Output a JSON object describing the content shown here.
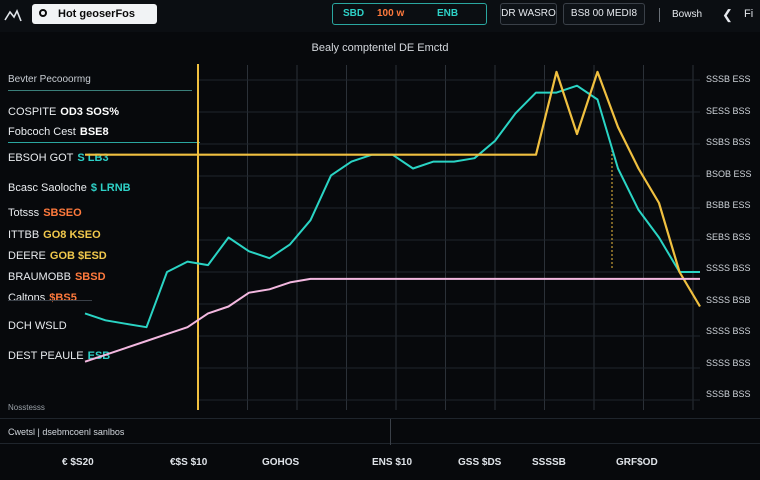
{
  "topbar": {
    "title": "Hot geoserFos",
    "ticker": {
      "symbol": "SBD",
      "value": "100 w",
      "change": "ENB"
    },
    "buttons": [
      "DR WASRO",
      "BS8 00 MEDI8"
    ],
    "search_label": "Bowsh",
    "back_glyph": "❮",
    "last_label": "Fi"
  },
  "chart_title": "Bealy comptentel DE Emctd",
  "left_panel": {
    "header": "Bevter Pecooormg",
    "rows": [
      {
        "label": "COSPITE",
        "value": "OD3 SOS%",
        "value_color": "#ffffff"
      },
      {
        "label": "Fobcoch Cest",
        "value": "BSE8",
        "value_color": "#ffffff"
      },
      {
        "label": "EBSOH GOT",
        "value": "S LB3",
        "value_color": "#2ed1c7"
      },
      {
        "label": "Bcasc Saoloche",
        "value": "$ LRNB",
        "value_color": "#2ed1c7"
      },
      {
        "label": "Totsss",
        "value": "SBSEO",
        "value_color": "#ff7a3d"
      },
      {
        "label": "ITTBB",
        "value": "GO8 KSEO",
        "value_color": "#f2c94c"
      },
      {
        "label": "DEERE",
        "value": "GOB $ESD",
        "value_color": "#f2c94c"
      },
      {
        "label": "BRAUMOBB",
        "value": "SBSD",
        "value_color": "#ff7a3d"
      },
      {
        "label": "Caltons",
        "value": "$BS5",
        "value_color": "#ff7a3d"
      },
      {
        "label": "DCH WSLD",
        "value": "",
        "value_color": "#ffffff"
      },
      {
        "label": "DEST PEAULE",
        "value": "ESB",
        "value_color": "#2ed1c7"
      }
    ],
    "footer": "Nosstesss"
  },
  "footer": {
    "left_text": "Cwetsl | dsebmcoenl sanlbos"
  },
  "chart_data": {
    "type": "line",
    "x": [
      0,
      1,
      2,
      3,
      4,
      5,
      6,
      7,
      8,
      9,
      10,
      11,
      12,
      13,
      14,
      15,
      16,
      17,
      18,
      19,
      20,
      21,
      22,
      23,
      24,
      25,
      26,
      27,
      28,
      29,
      30
    ],
    "xlim": [
      0,
      30
    ],
    "ylim": [
      0,
      100
    ],
    "x_tick_labels": [
      "€ $S20",
      "€$S $10",
      "GOHOS",
      "ENS $10",
      "GSS $DS",
      "SSSSB",
      "GRF$OD"
    ],
    "y_tick_labels": [
      "SSSB ESS",
      "SESS BSS",
      "SSBS BSS",
      "BSOB ESS",
      "BSBB ESS",
      "SEBS BSS",
      "SSSS BSS",
      "SSSS BSB",
      "SSSS BSS",
      "SSSS BSS",
      "SSSB BSS"
    ],
    "series": [
      {
        "color": "#2ad4c4",
        "values": [
          28,
          26,
          25,
          24,
          40,
          43,
          42,
          50,
          46,
          44,
          48,
          55,
          68,
          72,
          74,
          74,
          70,
          72,
          72,
          73,
          78,
          86,
          92,
          92,
          94,
          90,
          70,
          58,
          50,
          40,
          40
        ]
      },
      {
        "color": "#f0c040",
        "values": [
          74,
          74,
          74,
          74,
          74,
          74,
          74,
          74,
          74,
          74,
          74,
          74,
          74,
          74,
          74,
          74,
          74,
          74,
          74,
          74,
          74,
          74,
          74,
          98,
          80,
          98,
          82,
          70,
          60,
          40,
          30
        ]
      },
      {
        "color": "#f3b8e0",
        "values": [
          14,
          16,
          18,
          20,
          22,
          24,
          28,
          30,
          34,
          35,
          37,
          38,
          38,
          38,
          38,
          38,
          38,
          38,
          38,
          38,
          38,
          38,
          38,
          38,
          38,
          38,
          38,
          38,
          38,
          38,
          38
        ]
      }
    ]
  },
  "colors": {
    "accent": "#2aa7a0",
    "background": "#07090c"
  }
}
